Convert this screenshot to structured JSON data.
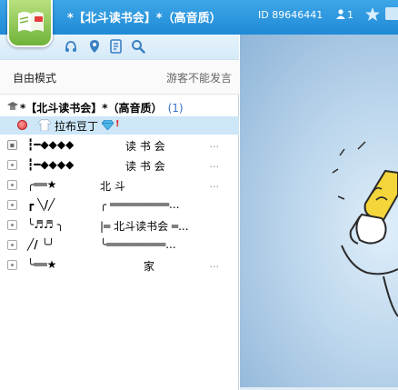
{
  "header": {
    "room_title": "*【北斗读书会】*（高音质）",
    "room_id": "ID 89646441",
    "online_count": "1"
  },
  "toolbar": {
    "icons": [
      "headset-icon",
      "location-icon",
      "notes-icon",
      "search-icon"
    ]
  },
  "mode": {
    "label": "自由模式",
    "guest_notice": "游客不能发言"
  },
  "channels": {
    "root": {
      "name": "*【北斗读书会】*（高音质）",
      "count": "(1)"
    },
    "current_user": {
      "name": "拉布豆丁",
      "badge": "!"
    },
    "rows": [
      {
        "name": "┇━◆◆◆◆",
        "middle": "读 书 会",
        "dots": "..."
      },
      {
        "name": "┇━◆◆◆◆",
        "middle": "读 书 会",
        "dots": "..."
      },
      {
        "name": "╭══★",
        "middle": "北                斗",
        "dots": "..."
      },
      {
        "name": "┏ ╲/╱",
        "middle": "╭ ═════════...",
        "dots": ""
      },
      {
        "name": "╰♬♬ ╮",
        "middle": "|═ 北斗读书会 ═...",
        "dots": ""
      },
      {
        "name": "╱/  ╰╯",
        "middle": "╰═════════...",
        "dots": ""
      },
      {
        "name": "╰══★",
        "middle": "家",
        "dots": "..."
      }
    ]
  }
}
